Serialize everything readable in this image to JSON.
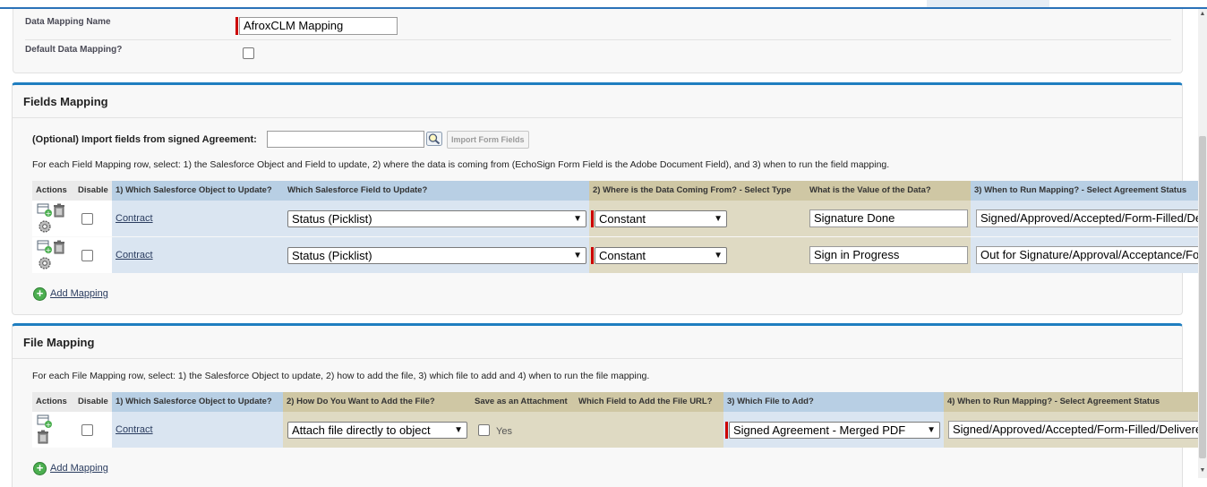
{
  "general": {
    "data_mapping_name_label": "Data Mapping Name",
    "data_mapping_name_value": "AfroxCLM Mapping",
    "default_label": "Default Data Mapping?"
  },
  "fields_mapping": {
    "title": "Fields Mapping",
    "import_label": "(Optional) Import fields from signed Agreement:",
    "import_button": "Import Form Fields",
    "help": "For each Field Mapping row, select: 1) the Salesforce Object and Field to update, 2) where the data is coming from (EchoSign Form Field is the Adobe Document Field), and 3) when to run the field mapping.",
    "headers": {
      "actions": "Actions",
      "disable": "Disable",
      "object": "1) Which Salesforce Object to Update?",
      "field": "Which Salesforce Field to Update?",
      "source_type": "2) Where is the Data Coming From? - Select Type",
      "value": "What is the Value of the Data?",
      "when": "3) When to Run Mapping? - Select Agreement Status"
    },
    "rows": [
      {
        "object": "Contract",
        "field": "Status (Picklist)",
        "source_type": "Constant",
        "value": "Signature Done",
        "when": "Signed/Approved/Accepted/Form-Filled/Delivered"
      },
      {
        "object": "Contract",
        "field": "Status (Picklist)",
        "source_type": "Constant",
        "value": "Sign in Progress",
        "when": "Out for Signature/Approval/Acceptance/Form-Filling/Delivery"
      }
    ],
    "add_mapping": "Add Mapping"
  },
  "file_mapping": {
    "title": "File Mapping",
    "help": "For each File Mapping row, select: 1) the Salesforce Object to update, 2) how to add the file, 3) which file to add and 4) when to run the file mapping.",
    "headers": {
      "actions": "Actions",
      "disable": "Disable",
      "object": "1) Which Salesforce Object to Update?",
      "how": "2) How Do You Want to Add the File?",
      "attachment": "Save as an Attachment",
      "url_field": "Which Field to Add the File URL?",
      "which_file": "3) Which File to Add?",
      "when": "4) When to Run Mapping? - Select Agreement Status"
    },
    "rows": [
      {
        "object": "Contract",
        "how": "Attach file directly to object",
        "attachment_label": "Yes",
        "which_file": "Signed Agreement - Merged PDF",
        "when": "Signed/Approved/Accepted/Form-Filled/Delivered"
      }
    ],
    "add_mapping": "Add Mapping"
  },
  "colors": {
    "accent": "#1f7ec0",
    "required": "#cc0000",
    "header_blue": "#b8cfe4",
    "header_tan": "#cfc7a4"
  }
}
